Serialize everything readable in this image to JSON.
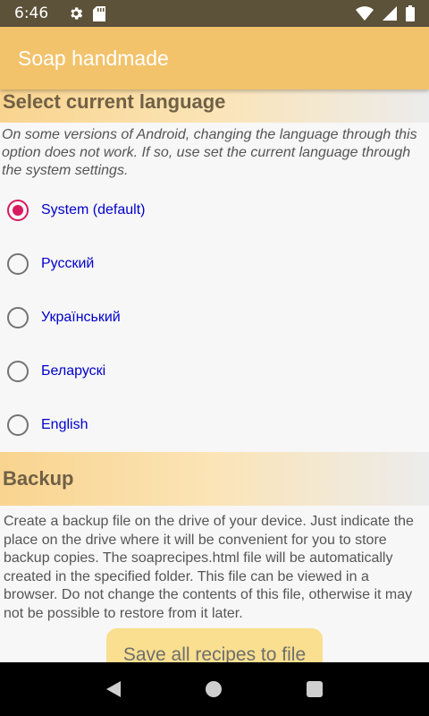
{
  "status_bar": {
    "time": "6:46"
  },
  "app_bar": {
    "title": "Soap handmade"
  },
  "language_section": {
    "title": "Select current language",
    "note": "On some versions of Android, changing the language through this option does not work. If so, use set the current language through the system settings.",
    "options": [
      {
        "label": "System (default)",
        "selected": true
      },
      {
        "label": "Русский",
        "selected": false
      },
      {
        "label": "Український",
        "selected": false
      },
      {
        "label": "Беларускі",
        "selected": false
      },
      {
        "label": "English",
        "selected": false
      }
    ]
  },
  "backup_section": {
    "title": "Backup",
    "description": "Create a backup file on the drive of your device. Just indicate the place on the drive where it will be convenient for you to store backup copies. The soaprecipes.html file will be automatically created in the specified folder. This file can be viewed in a browser. Do not change the contents of this file, otherwise it may not be possible to restore from it later.",
    "save_button": "Save all recipes to file"
  },
  "colors": {
    "accent": "#d81b60",
    "app_bar": "#f2c36b",
    "label": "#0000cc",
    "button": "#f9df8f"
  }
}
